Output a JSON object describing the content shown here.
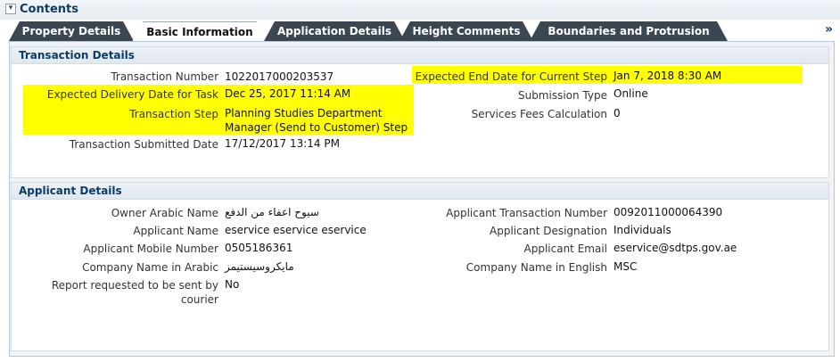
{
  "header": {
    "title": "Contents",
    "toggle_icon": "▾"
  },
  "tabs": [
    {
      "label": "Property Details"
    },
    {
      "label": "Basic Information"
    },
    {
      "label": "Application Details"
    },
    {
      "label": "Height Comments"
    },
    {
      "label": "Boundaries and Protrusion"
    }
  ],
  "overflow_icon": "»",
  "transaction": {
    "title": "Transaction Details",
    "left": [
      {
        "label": "Transaction Number",
        "value": "1022017000203537"
      },
      {
        "label": "Expected Delivery Date for Task",
        "value": "Dec 25, 2017 11:14 AM"
      },
      {
        "label": "Transaction Step",
        "value": "Planning Studies Department Manager (Send to Customer) Step"
      },
      {
        "label": "Transaction Submitted Date",
        "value": "17/12/2017 13:14 PM"
      }
    ],
    "right": [
      {
        "label": "Expected End Date for Current Step",
        "value": "Jan 7, 2018 8:30 AM"
      },
      {
        "label": "Submission Type",
        "value": "Online"
      },
      {
        "label": "Services Fees Calculation",
        "value": "0"
      }
    ]
  },
  "applicant": {
    "title": "Applicant Details",
    "left": [
      {
        "label": "Owner Arabic Name",
        "value": "سيوح اعفاء من الدفع"
      },
      {
        "label": "Applicant Name",
        "value": "eservice eservice eservice"
      },
      {
        "label": "Applicant Mobile Number",
        "value": "0505186361"
      },
      {
        "label": "Company Name in Arabic",
        "value": "مايكروسيستيمز"
      },
      {
        "label": "Report requested to be sent by courier",
        "value": "No"
      }
    ],
    "right": [
      {
        "label": "Applicant Transaction Number",
        "value": "0092011000064390"
      },
      {
        "label": "Applicant Designation",
        "value": "Individuals"
      },
      {
        "label": "Applicant Email",
        "value": "eservice@sdtps.gov.ae"
      },
      {
        "label": "Company Name in English",
        "value": "MSC"
      }
    ]
  },
  "colors": {
    "highlight": "#ffff00",
    "tab_dark": "#3c4653",
    "title_blue": "#0b3c66"
  }
}
